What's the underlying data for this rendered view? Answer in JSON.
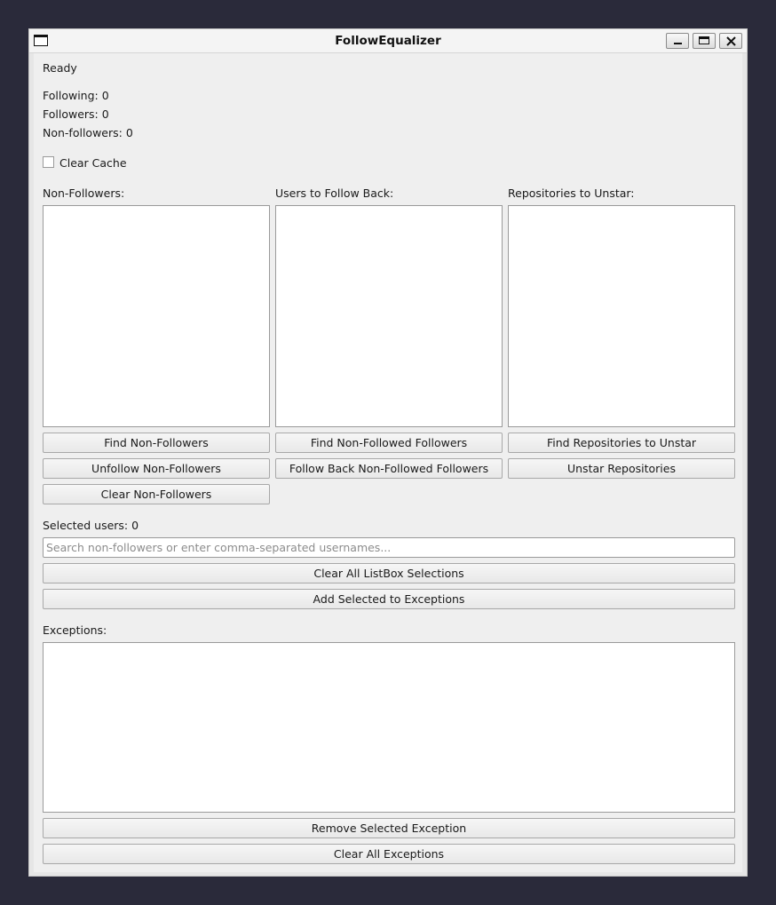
{
  "window": {
    "title": "FollowEqualizer",
    "icons": {
      "app": "window-icon",
      "minimize": "minimize-icon",
      "maximize": "maximize-icon",
      "close": "close-icon"
    }
  },
  "status": {
    "text": "Ready",
    "following": "Following: 0",
    "followers": "Followers: 0",
    "non_followers": "Non-followers: 0"
  },
  "clear_cache": {
    "label": "Clear Cache",
    "checked": false
  },
  "columns": {
    "non_followers": {
      "heading": "Non-Followers:",
      "buttons": [
        "Find Non-Followers",
        "Unfollow Non-Followers",
        "Clear Non-Followers"
      ]
    },
    "follow_back": {
      "heading": "Users to Follow Back:",
      "buttons": [
        "Find Non-Followed Followers",
        "Follow Back Non-Followed Followers"
      ]
    },
    "unstar": {
      "heading": "Repositories to Unstar:",
      "buttons": [
        "Find Repositories to Unstar",
        "Unstar Repositories"
      ]
    }
  },
  "selection": {
    "selected_users": "Selected users: 0",
    "search_placeholder": "Search non-followers or enter comma-separated usernames...",
    "search_value": "",
    "clear_selections": "Clear All ListBox Selections",
    "add_exceptions": "Add Selected to Exceptions"
  },
  "exceptions": {
    "heading": "Exceptions:",
    "remove_selected": "Remove Selected Exception",
    "clear_all": "Clear All Exceptions"
  }
}
